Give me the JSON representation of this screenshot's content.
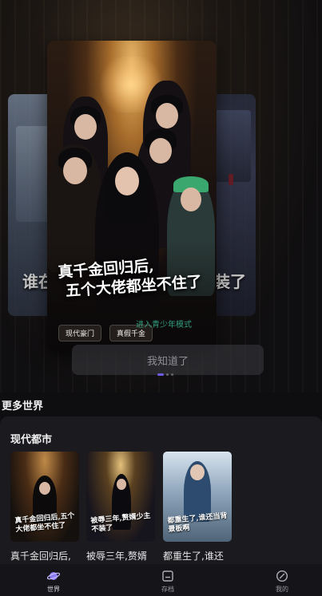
{
  "carousel": {
    "featured": {
      "title_line1": "真千金回归后,",
      "title_line2": "五个大佬都坐不住了",
      "tags": [
        "现代豪门",
        "真假千金"
      ]
    },
    "left_peek_text": "谁在",
    "right_peek_text": "装了",
    "youth_mode_tip": "进入青少年模式",
    "confirm_label": "我知道了",
    "page_count": 3,
    "active_index": 0
  },
  "more_worlds": {
    "title": "更多世界",
    "category": "现代都市",
    "books": [
      {
        "name": "真千金回归后,",
        "cover_text": "真千金回归后,五个大佬都坐不住了"
      },
      {
        "name": "被辱三年,赘婿",
        "cover_text": "被辱三年,赘婿少主不装了"
      },
      {
        "name": "都重生了,谁还",
        "cover_text": "都重生了,谁还当背景板啊"
      }
    ]
  },
  "bottom_nav": [
    {
      "label": "世界",
      "icon": "planet-icon",
      "active": true
    },
    {
      "label": "存档",
      "icon": "archive-icon",
      "active": false
    },
    {
      "label": "我的",
      "icon": "profile-icon",
      "active": false
    }
  ],
  "colors": {
    "accent": "#6d5ce7",
    "youth_tip": "#3bbf9a",
    "background": "#0e0d10",
    "panel": "#1b1a1f"
  }
}
